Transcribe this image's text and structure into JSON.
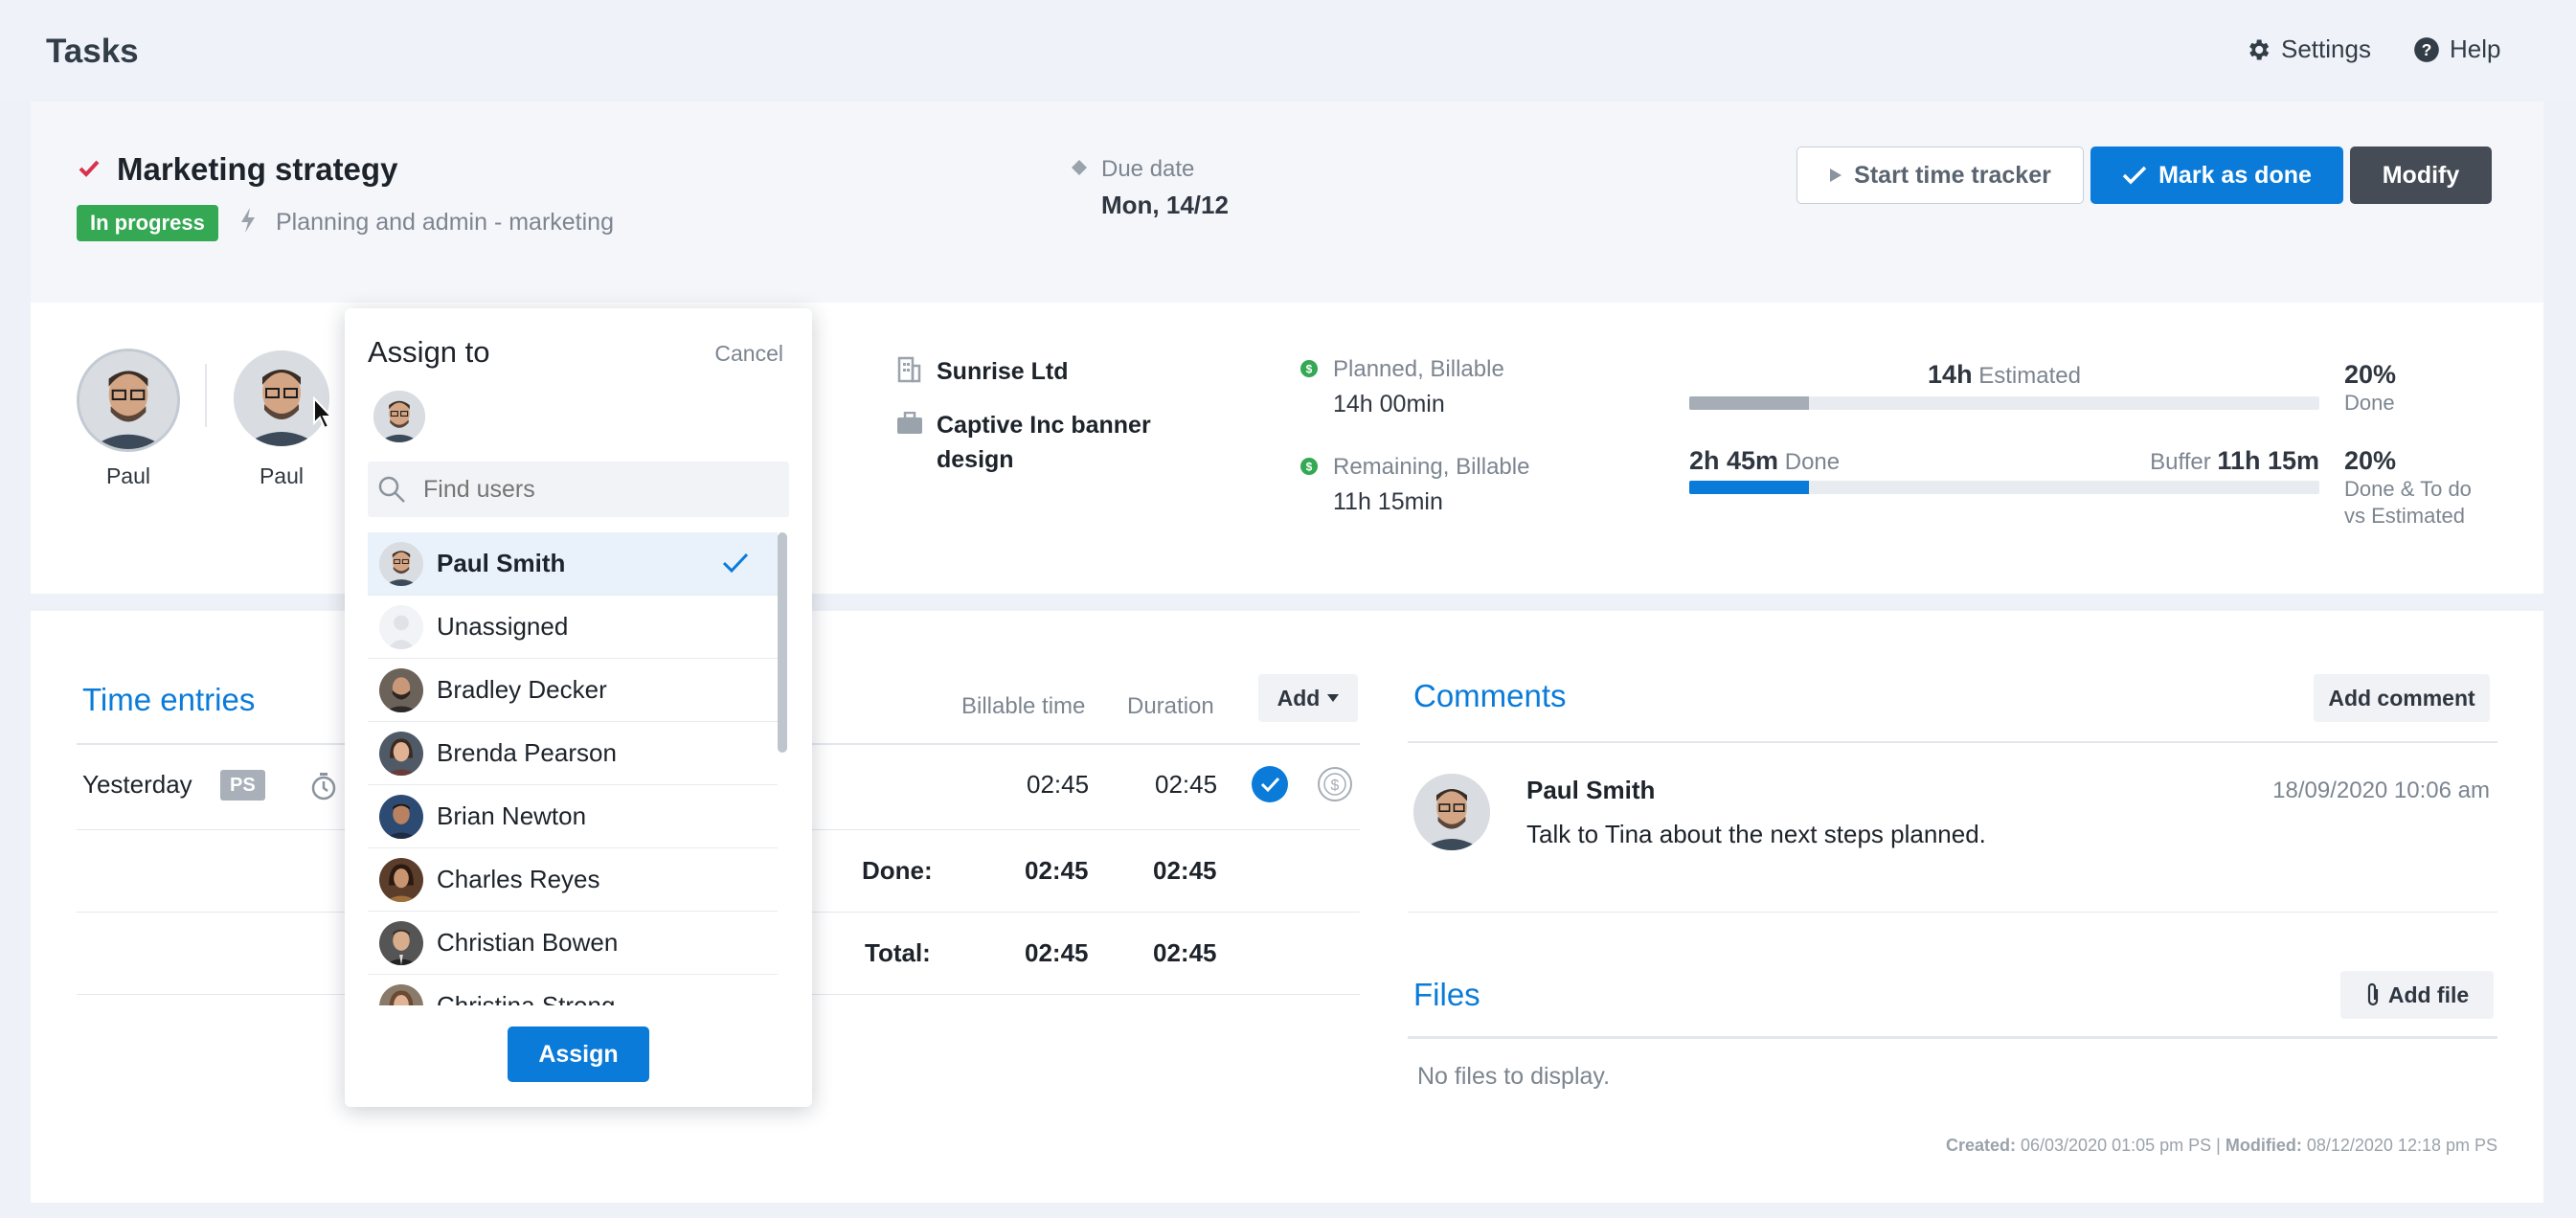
{
  "app": {
    "title": "Tasks",
    "settings_label": "Settings",
    "help_label": "Help"
  },
  "task": {
    "title": "Marketing strategy",
    "status": "In progress",
    "project": "Planning and admin - marketing",
    "due_label": "Due date",
    "due_value": "Mon, 14/12",
    "start_tracker": "Start time tracker",
    "mark_done": "Mark as done",
    "modify": "Modify"
  },
  "assignees": [
    {
      "name": "Paul"
    },
    {
      "name": "Paul"
    }
  ],
  "client": {
    "company": "Sunrise Ltd",
    "project_line1": "Captive Inc banner",
    "project_line2": "design"
  },
  "planned": {
    "label": "Planned, Billable",
    "value": "14h 00min"
  },
  "remaining": {
    "label": "Remaining, Billable",
    "value": "11h 15min"
  },
  "progress": {
    "estimated_value": "14h",
    "estimated_label": "Estimated",
    "done_value": "2h 45m",
    "done_label": "Done",
    "buffer_label": "Buffer",
    "buffer_value": "11h 15m",
    "done_pct": "20%",
    "done_pct_label": "Done",
    "todo_pct": "20%",
    "todo_pct_label_1": "Done & To do",
    "todo_pct_label_2": "vs Estimated",
    "estimated_fill": 0.19,
    "done_fill": 0.19,
    "colors": {
      "estimated": "#a6adb6",
      "done": "#0a7bd9"
    }
  },
  "time_entries": {
    "title": "Time entries",
    "col_billable": "Billable time",
    "col_duration": "Duration",
    "add_label": "Add",
    "row": {
      "date": "Yesterday",
      "badge": "PS",
      "billable": "02:45",
      "duration": "02:45"
    },
    "done_label": "Done:",
    "done_billable": "02:45",
    "done_duration": "02:45",
    "total_label": "Total:",
    "total_billable": "02:45",
    "total_duration": "02:45"
  },
  "comments": {
    "title": "Comments",
    "add_label": "Add comment",
    "items": [
      {
        "author": "Paul Smith",
        "time": "18/09/2020 10:06 am",
        "text": "Talk to Tina about the next steps planned."
      }
    ]
  },
  "files": {
    "title": "Files",
    "add_label": "Add file",
    "empty": "No files to display."
  },
  "footer": {
    "created_label": "Created:",
    "created_value": "06/03/2020 01:05 pm PS",
    "modified_label": "Modified:",
    "modified_value": "08/12/2020 12:18 pm PS"
  },
  "assign_popup": {
    "title": "Assign to",
    "cancel": "Cancel",
    "search_placeholder": "Find users",
    "assign_label": "Assign",
    "users": [
      {
        "name": "Paul Smith",
        "selected": true
      },
      {
        "name": "Unassigned"
      },
      {
        "name": "Bradley Decker"
      },
      {
        "name": "Brenda Pearson"
      },
      {
        "name": "Brian Newton"
      },
      {
        "name": "Charles Reyes"
      },
      {
        "name": "Christian Bowen"
      },
      {
        "name": "Christina Strong"
      }
    ]
  }
}
